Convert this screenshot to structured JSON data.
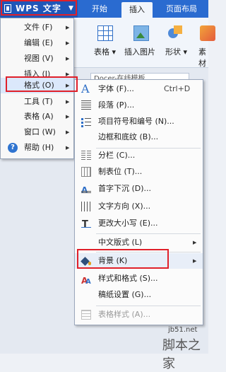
{
  "app": {
    "title": "WPS 文字"
  },
  "tabs": [
    "开始",
    "插入",
    "页面布局"
  ],
  "active_tab": 1,
  "ribbon": {
    "items": [
      "表格 ▾",
      "插入图片",
      "形状 ▾",
      "素材"
    ]
  },
  "document_tab": "Docer-在线模板",
  "main_menu": {
    "items": [
      {
        "label": "文件 (F)",
        "icon": "",
        "has_submenu": true
      },
      {
        "label": "编辑 (E)",
        "icon": "",
        "has_submenu": true
      },
      {
        "label": "视图 (V)",
        "icon": "",
        "has_submenu": true
      },
      {
        "label": "插入 (I)",
        "icon": "",
        "has_submenu": true
      },
      {
        "label": "格式 (O)",
        "icon": "",
        "has_submenu": true,
        "highlighted": true
      },
      {
        "label": "工具 (T)",
        "icon": "",
        "has_submenu": true
      },
      {
        "label": "表格 (A)",
        "icon": "",
        "has_submenu": true
      },
      {
        "label": "窗口 (W)",
        "icon": "",
        "has_submenu": true
      },
      {
        "label": "帮助 (H)",
        "icon": "help-icon",
        "has_submenu": true
      }
    ]
  },
  "format_menu": {
    "items": [
      {
        "label": "字体 (F)...",
        "shortcut": "Ctrl+D",
        "icon": "font-icon"
      },
      {
        "label": "段落 (P)...",
        "shortcut": "",
        "icon": "paragraph-icon"
      },
      {
        "label": "项目符号和编号 (N)...",
        "shortcut": "",
        "icon": "bullets-icon"
      },
      {
        "label": "边框和底纹 (B)...",
        "shortcut": "",
        "icon": ""
      },
      {
        "separator": true
      },
      {
        "label": "分栏 (C)...",
        "shortcut": "",
        "icon": "columns-icon"
      },
      {
        "label": "制表位 (T)...",
        "shortcut": "",
        "icon": "tab-stops-icon"
      },
      {
        "label": "首字下沉 (D)...",
        "shortcut": "",
        "icon": "drop-cap-icon"
      },
      {
        "label": "文字方向 (X)...",
        "shortcut": "",
        "icon": "text-direction-icon"
      },
      {
        "label": "更改大小写 (E)...",
        "shortcut": "",
        "icon": "change-case-icon"
      },
      {
        "separator": true
      },
      {
        "label": "中文版式 (L)",
        "shortcut": "",
        "icon": "",
        "has_submenu": true
      },
      {
        "separator": true
      },
      {
        "label": "背景 (K)",
        "shortcut": "",
        "icon": "paint-bucket-icon",
        "has_submenu": true,
        "highlighted": true
      },
      {
        "label": "样式和格式 (S)...",
        "shortcut": "",
        "icon": "styles-icon"
      },
      {
        "label": "稿纸设置 (G)...",
        "shortcut": "",
        "icon": ""
      },
      {
        "separator": true
      },
      {
        "label": "表格样式 (A)...",
        "shortcut": "",
        "icon": "table-style-icon",
        "disabled": true
      }
    ]
  },
  "watermark": {
    "site": "jb51.net",
    "name": "脚本之家"
  },
  "colors": {
    "accent": "#2a6bd0",
    "highlight_box": "#e0202a"
  }
}
